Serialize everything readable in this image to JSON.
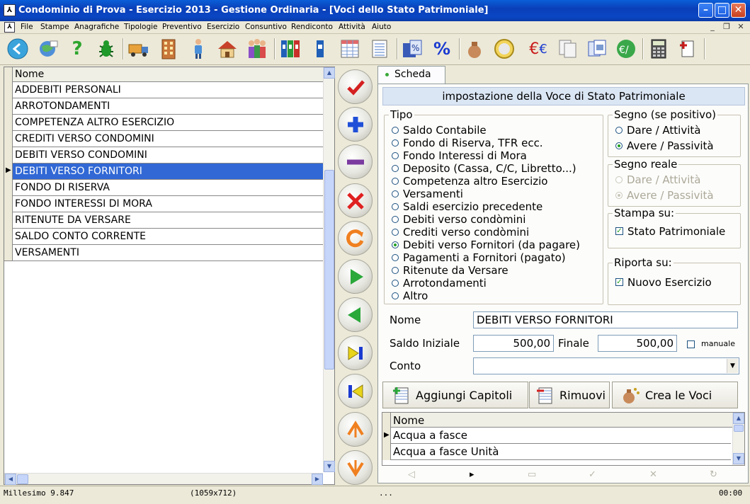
{
  "window": {
    "title": "Condominio di Prova - Esercizio 2013 - Gestione Ordinaria - [Voci dello Stato Patrimoniale]"
  },
  "menu": [
    "File",
    "Stampe",
    "Anagrafiche",
    "Tipologie",
    "Preventivo",
    "Esercizio",
    "Consuntivo",
    "Rendiconto",
    "Attività",
    "Aiuto"
  ],
  "toolbar": {
    "icons": [
      "back-icon",
      "internet-icon",
      "help-icon",
      "bug-icon",
      "truck-icon",
      "building-icon",
      "person-icon",
      "house-icon",
      "people-icon",
      "binders-icon",
      "binder-icon",
      "table-icon",
      "list-icon",
      "calc-percent-icon",
      "percent-icon",
      "sack-icon",
      "euro-coin-icon",
      "euro-sign-icon",
      "copy-icon",
      "pages-icon",
      "euro-percent-icon",
      "calculator-icon",
      "add-doc-icon"
    ]
  },
  "grid": {
    "header": "Nome",
    "rows": [
      "ADDEBITI PERSONALI",
      "ARROTONDAMENTI",
      "COMPETENZA ALTRO ESERCIZIO",
      "CREDITI VERSO CONDOMINI",
      "DEBITI VERSO CONDOMINI",
      "DEBITI VERSO FORNITORI",
      "FONDO DI RISERVA",
      "FONDO INTERESSI DI MORA",
      "RITENUTE DA VERSARE",
      "SALDO CONTO CORRENTE",
      "VERSAMENTI"
    ],
    "selected_index": 5
  },
  "form": {
    "tab": "Scheda",
    "band": "impostazione della Voce di Stato Patrimoniale",
    "tipo": {
      "caption": "Tipo",
      "options": [
        "Saldo Contabile",
        "Fondo di Riserva, TFR ecc.",
        "Fondo Interessi di Mora",
        "Deposito (Cassa, C/C, Libretto...)",
        "Competenza altro Esercizio",
        "Versamenti",
        "Saldi esercizio precedente",
        "Debiti verso condòmini",
        "Crediti verso condòmini",
        "Debiti verso Fornitori (da pagare)",
        "Pagamenti a Fornitori (pagato)",
        "Ritenute da Versare",
        "Arrotondamenti",
        "Altro"
      ],
      "selected_index": 9
    },
    "segno": {
      "caption": "Segno (se positivo)",
      "options": [
        "Dare / Attività",
        "Avere / Passività"
      ],
      "selected_index": 1
    },
    "segno_reale": {
      "caption": "Segno reale",
      "options": [
        "Dare / Attività",
        "Avere / Passività"
      ],
      "selected_index": 1
    },
    "stampa": {
      "caption": "Stampa su:",
      "checkbox": "Stato Patrimoniale",
      "checked": true
    },
    "riporta": {
      "caption": "Riporta su:",
      "checkbox": "Nuovo Esercizio",
      "checked": true
    },
    "nome_label": "Nome",
    "nome_value": "DEBITI VERSO FORNITORI",
    "saldo_label": "Saldo Iniziale",
    "saldo_value": "500,00",
    "finale_label": "Finale",
    "finale_value": "500,00",
    "manuale_label": "manuale",
    "manuale_checked": false,
    "conto_label": "Conto",
    "conto_value": "",
    "buttons": {
      "aggiungi": "Aggiungi Capitoli",
      "rimuovi": "Rimuovi",
      "crea": "Crea le Voci"
    },
    "voci": {
      "header": "Nome",
      "rows": [
        "Acqua a fasce",
        "Acqua a fasce Unità"
      ]
    }
  },
  "status": {
    "left": "Millesimo 9.847",
    "size": "(1059x712)",
    "mid": "...",
    "time": "00:00"
  }
}
